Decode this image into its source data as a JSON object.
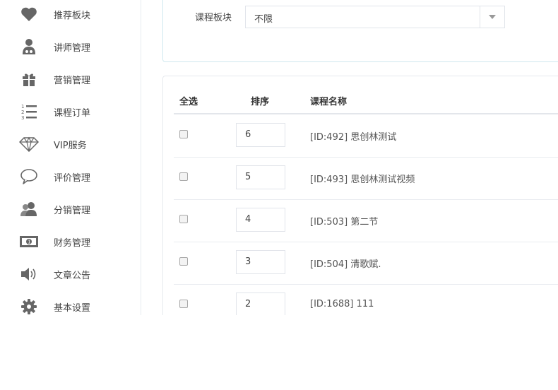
{
  "sidebar": {
    "items": [
      {
        "label": "推荐板块",
        "icon": "heart-icon"
      },
      {
        "label": "讲师管理",
        "icon": "lecturer-icon"
      },
      {
        "label": "营销管理",
        "icon": "gift-icon"
      },
      {
        "label": "课程订单",
        "icon": "ordered-list-icon"
      },
      {
        "label": "VIP服务",
        "icon": "diamond-icon"
      },
      {
        "label": "评价管理",
        "icon": "comment-bubble-icon"
      },
      {
        "label": "分销管理",
        "icon": "users-icon"
      },
      {
        "label": "财务管理",
        "icon": "money-icon"
      },
      {
        "label": "文章公告",
        "icon": "speaker-icon"
      },
      {
        "label": "基本设置",
        "icon": "gear-icon"
      }
    ]
  },
  "filter": {
    "label": "课程板块",
    "select_value": "不限",
    "truncated_label": "V"
  },
  "table": {
    "columns": {
      "select_all": "全选",
      "sort": "排序",
      "course_name": "课程名称"
    },
    "rows": [
      {
        "sort": "6",
        "name": "[ID:492] 思创林测试"
      },
      {
        "sort": "5",
        "name": "[ID:493] 思创林测试视频"
      },
      {
        "sort": "4",
        "name": "[ID:503] 第二节"
      },
      {
        "sort": "3",
        "name": "[ID:504] 清歌赋."
      },
      {
        "sort": "2",
        "name": "[ID:1688] 111"
      }
    ]
  },
  "colors": {
    "icon": "#666666",
    "accent_border": "#cfe8ef"
  }
}
